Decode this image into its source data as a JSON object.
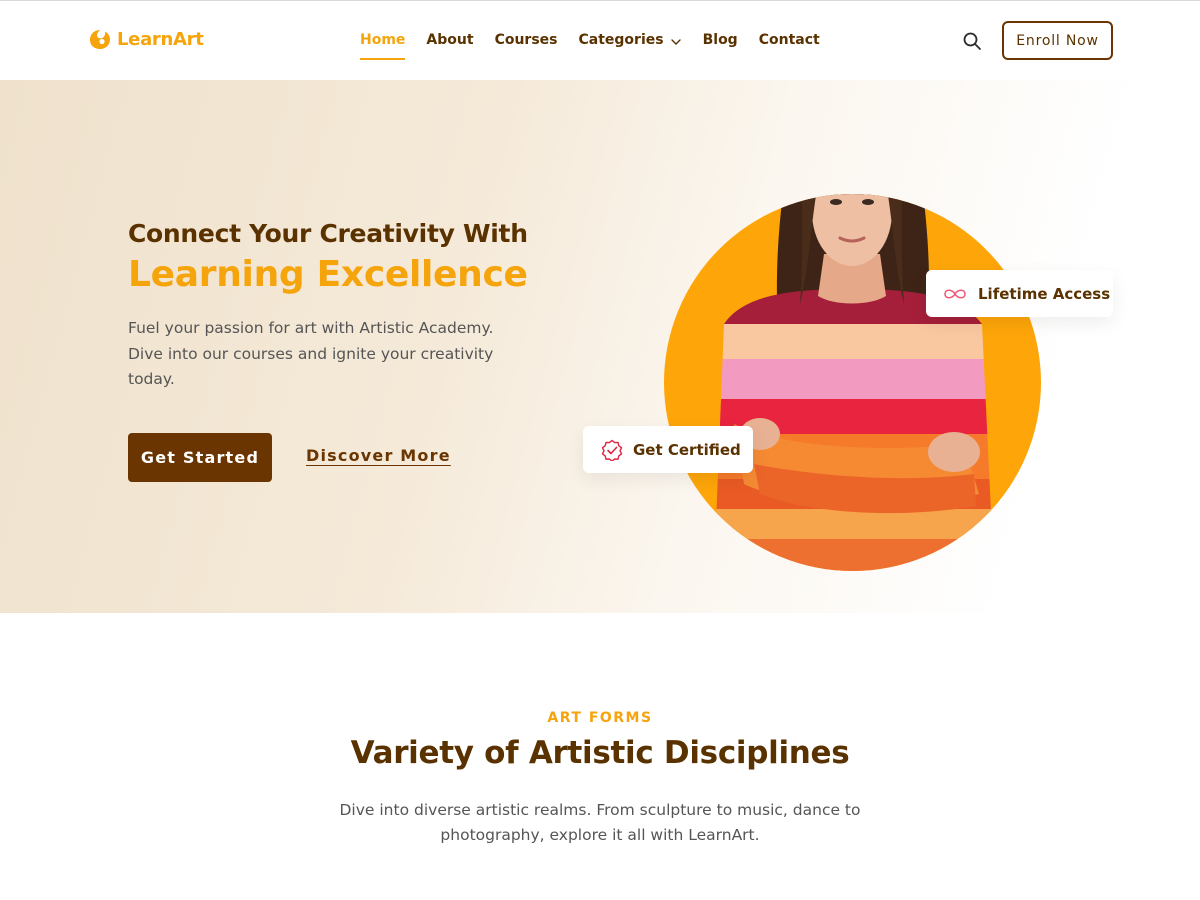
{
  "brand": {
    "name": "LearnArt",
    "accent": "#f5a40c",
    "dark": "#5a3200"
  },
  "nav": {
    "items": [
      {
        "label": "Home",
        "active": true
      },
      {
        "label": "About"
      },
      {
        "label": "Courses"
      },
      {
        "label": "Categories",
        "has_dropdown": true
      },
      {
        "label": "Blog"
      },
      {
        "label": "Contact"
      }
    ],
    "search_icon": "search-icon",
    "enroll_label": "Enroll Now"
  },
  "hero": {
    "title_line1": "Connect Your Creativity With",
    "title_line2": "Learning Excellence",
    "description": "Fuel your passion for art with Artistic Academy. Dive into our courses and ignite your creativity today.",
    "primary_cta": "Get Started",
    "secondary_cta": "Discover More",
    "badge_lifetime": "Lifetime Access",
    "badge_certified": "Get Certified"
  },
  "art_forms": {
    "eyebrow": "ART FORMS",
    "title": "Variety of Artistic Disciplines",
    "description": "Dive into diverse artistic realms. From sculpture to music, dance to photography, explore it all with LearnArt."
  }
}
